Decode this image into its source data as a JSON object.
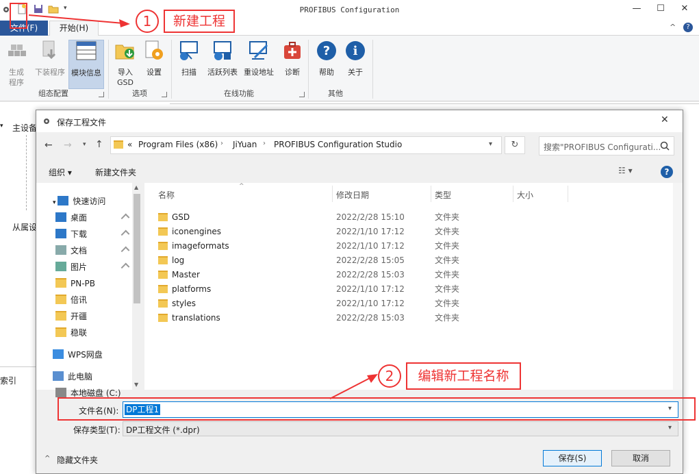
{
  "app": {
    "title": "PROFIBUS Configuration",
    "tabs": {
      "file": "文件(F)",
      "home": "开始(H)"
    },
    "window_controls": {
      "minimize": "—",
      "maximize": "☐",
      "close": "✕"
    },
    "help_glyph": "?",
    "collapse_glyph": "^"
  },
  "ribbon": {
    "groups": [
      {
        "label": "组态配置",
        "buttons": [
          {
            "label": "生成\n程序",
            "icon": "build-icon",
            "state": "disabled"
          },
          {
            "label": "下装程序",
            "icon": "download-icon",
            "state": "disabled"
          },
          {
            "label": "模块信息",
            "icon": "module-info-icon",
            "state": "active"
          }
        ]
      },
      {
        "label": "选项",
        "buttons": [
          {
            "label": "导入\nGSD",
            "icon": "import-gsd-icon",
            "state": "normal"
          },
          {
            "label": "设置",
            "icon": "settings-icon",
            "state": "normal"
          }
        ]
      },
      {
        "label": "在线功能",
        "buttons": [
          {
            "label": "扫描",
            "icon": "scan-icon",
            "state": "normal"
          },
          {
            "label": "活跃列表",
            "icon": "live-list-icon",
            "state": "normal"
          },
          {
            "label": "重设地址",
            "icon": "reset-address-icon",
            "state": "normal"
          },
          {
            "label": "诊断",
            "icon": "diagnose-icon",
            "state": "normal"
          }
        ]
      },
      {
        "label": "其他",
        "buttons": [
          {
            "label": "帮助",
            "icon": "help-icon",
            "state": "normal"
          },
          {
            "label": "关于",
            "icon": "about-icon",
            "state": "normal"
          }
        ]
      }
    ]
  },
  "background": {
    "tree_master": "主设备",
    "tree_slave": "从属设",
    "index_label": "索引"
  },
  "dialog": {
    "title": "保存工程文件",
    "close": "✕",
    "breadcrumb": [
      "«",
      "Program Files (x86)",
      "JiYuan",
      "PROFIBUS Configuration Studio"
    ],
    "search_placeholder": "搜索\"PROFIBUS Configurati...",
    "organize": "组织 ▾",
    "new_folder": "新建文件夹",
    "columns": {
      "name": "名称",
      "date": "修改日期",
      "type": "类型",
      "size": "大小"
    },
    "nav": [
      {
        "label": "快速访问",
        "icon": "star-icon",
        "pinned": false,
        "level": 0
      },
      {
        "label": "桌面",
        "icon": "desktop-icon",
        "pinned": true,
        "level": 1
      },
      {
        "label": "下载",
        "icon": "download-arrow-icon",
        "pinned": true,
        "level": 1
      },
      {
        "label": "文档",
        "icon": "document-icon",
        "pinned": true,
        "level": 1
      },
      {
        "label": "图片",
        "icon": "picture-icon",
        "pinned": true,
        "level": 1
      },
      {
        "label": "PN-PB",
        "icon": "folder-icon",
        "pinned": false,
        "level": 1
      },
      {
        "label": "倍讯",
        "icon": "folder-icon",
        "pinned": false,
        "level": 1
      },
      {
        "label": "开疆",
        "icon": "folder-icon",
        "pinned": false,
        "level": 1
      },
      {
        "label": "稳联",
        "icon": "folder-icon",
        "pinned": false,
        "level": 1
      },
      {
        "label": "WPS网盘",
        "icon": "cloud-icon",
        "pinned": false,
        "level": 0
      },
      {
        "label": "此电脑",
        "icon": "computer-icon",
        "pinned": false,
        "level": 0
      },
      {
        "label": "本地磁盘 (C:)",
        "icon": "drive-icon",
        "pinned": false,
        "level": 1
      }
    ],
    "files": [
      {
        "name": "GSD",
        "date": "2022/2/28 15:10",
        "type": "文件夹"
      },
      {
        "name": "iconengines",
        "date": "2022/1/10 17:12",
        "type": "文件夹"
      },
      {
        "name": "imageformats",
        "date": "2022/1/10 17:12",
        "type": "文件夹"
      },
      {
        "name": "log",
        "date": "2022/2/28 15:05",
        "type": "文件夹"
      },
      {
        "name": "Master",
        "date": "2022/2/28 15:03",
        "type": "文件夹"
      },
      {
        "name": "platforms",
        "date": "2022/1/10 17:12",
        "type": "文件夹"
      },
      {
        "name": "styles",
        "date": "2022/1/10 17:12",
        "type": "文件夹"
      },
      {
        "name": "translations",
        "date": "2022/2/28 15:03",
        "type": "文件夹"
      }
    ],
    "filename_label": "文件名(N):",
    "filename_value": "DP工程1",
    "filetype_label": "保存类型(T):",
    "filetype_value": "DP工程文件 (*.dpr)",
    "hide_folders": "隐藏文件夹",
    "save": "保存(S)",
    "cancel": "取消"
  },
  "annotations": [
    {
      "number": "1",
      "text": "新建工程"
    },
    {
      "number": "2",
      "text": "编辑新工程名称"
    }
  ],
  "colors": {
    "accent": "#2b579a",
    "annotation": "#e33333",
    "folder": "#f3c855"
  }
}
